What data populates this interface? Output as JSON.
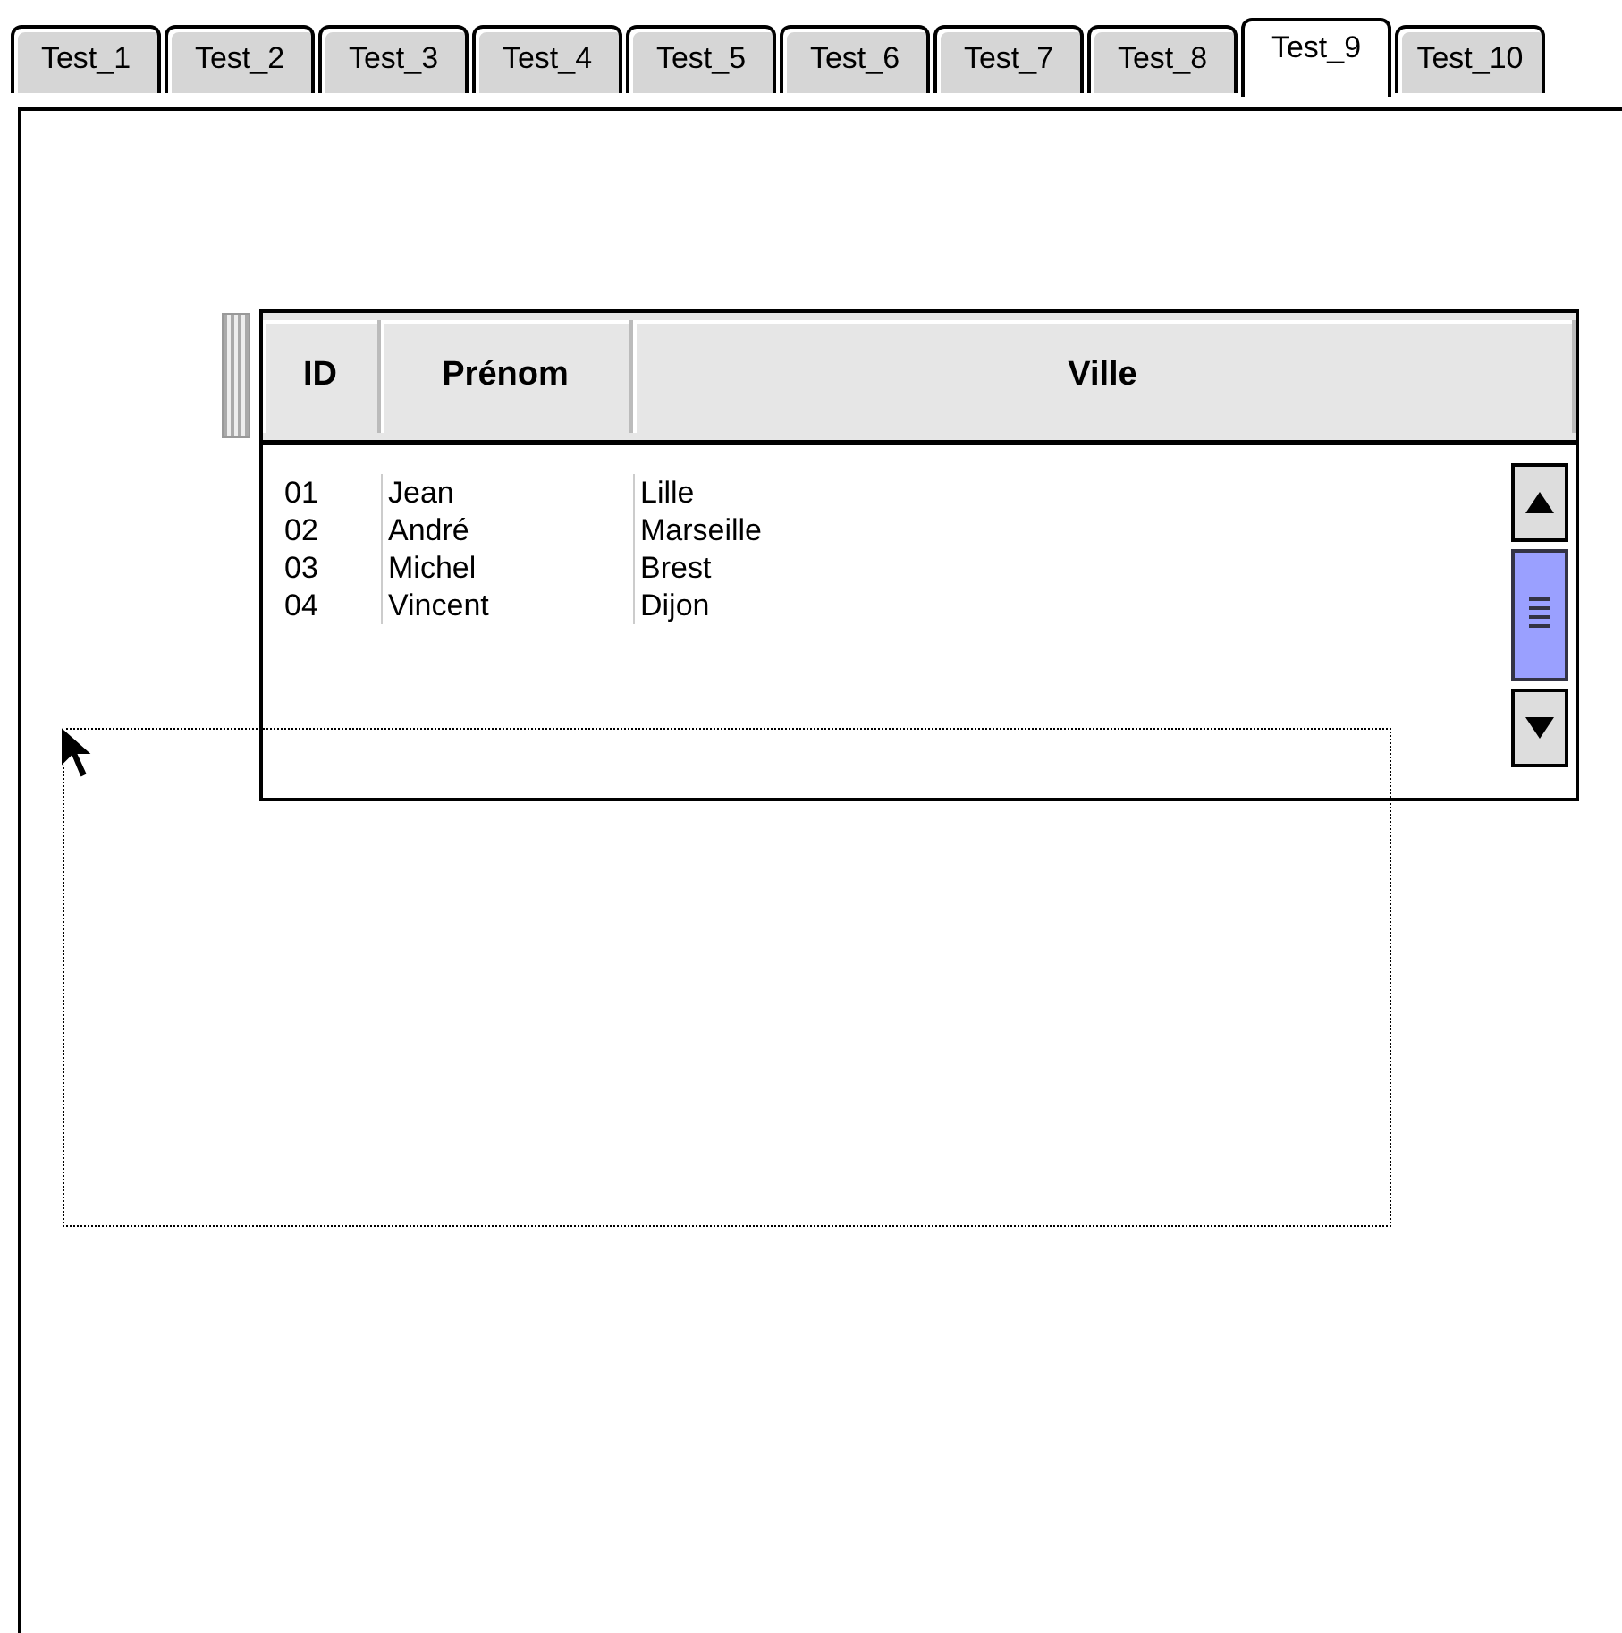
{
  "tabs": [
    {
      "label": "Test_1",
      "selected": false
    },
    {
      "label": "Test_2",
      "selected": false
    },
    {
      "label": "Test_3",
      "selected": false
    },
    {
      "label": "Test_4",
      "selected": false
    },
    {
      "label": "Test_5",
      "selected": false
    },
    {
      "label": "Test_6",
      "selected": false
    },
    {
      "label": "Test_7",
      "selected": false
    },
    {
      "label": "Test_8",
      "selected": false
    },
    {
      "label": "Test_9",
      "selected": true
    },
    {
      "label": "Test_10",
      "selected": false
    }
  ],
  "table": {
    "columns": [
      "ID",
      "Prénom",
      "Ville"
    ],
    "rows": [
      [
        "01",
        "Jean",
        "Lille"
      ],
      [
        "02",
        "André",
        "Marseille"
      ],
      [
        "03",
        "Michel",
        "Brest"
      ],
      [
        "04",
        "Vincent",
        "Dijon"
      ]
    ]
  }
}
